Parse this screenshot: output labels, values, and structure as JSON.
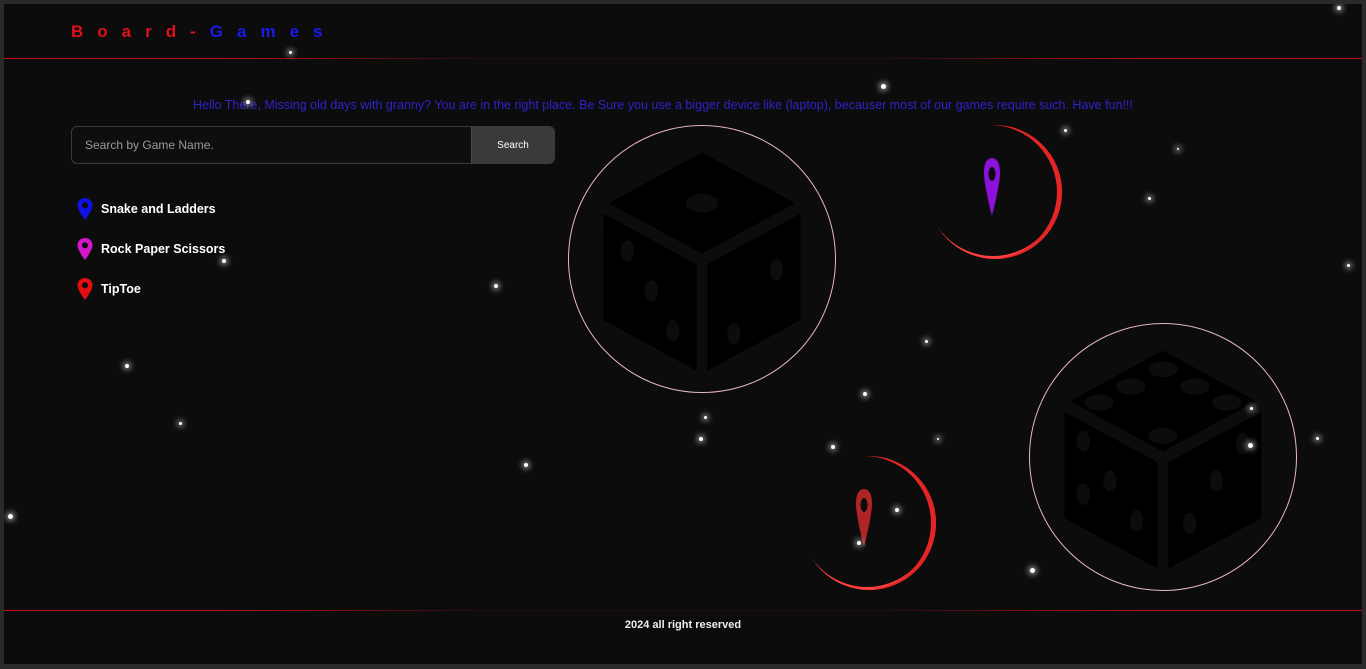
{
  "brand": {
    "part1": "Board",
    "separator": "-",
    "part2": "Games"
  },
  "greeting": "Hello There, Missing old days with granny? You are in the right place. Be Sure you use a bigger device like (laptop), becauser most of our games require such. Have fun!!!",
  "search": {
    "placeholder": "Search by Game Name.",
    "button_label": "Search"
  },
  "games": [
    {
      "label": "Snake and Ladders",
      "icon": "map-pin-icon",
      "color": "#1010e0"
    },
    {
      "label": "Rock Paper Scissors",
      "icon": "map-pin-icon",
      "color": "#d018c8"
    },
    {
      "label": "TipToe",
      "icon": "map-pin-icon",
      "color": "#e01010"
    }
  ],
  "footer": "2024 all right reserved",
  "colors": {
    "background": "#0c0c0d",
    "accent_red": "#e0101a",
    "accent_blue": "#1a1ae8",
    "greeting": "#2f22c9",
    "circle_border": "#e7b7c2"
  }
}
